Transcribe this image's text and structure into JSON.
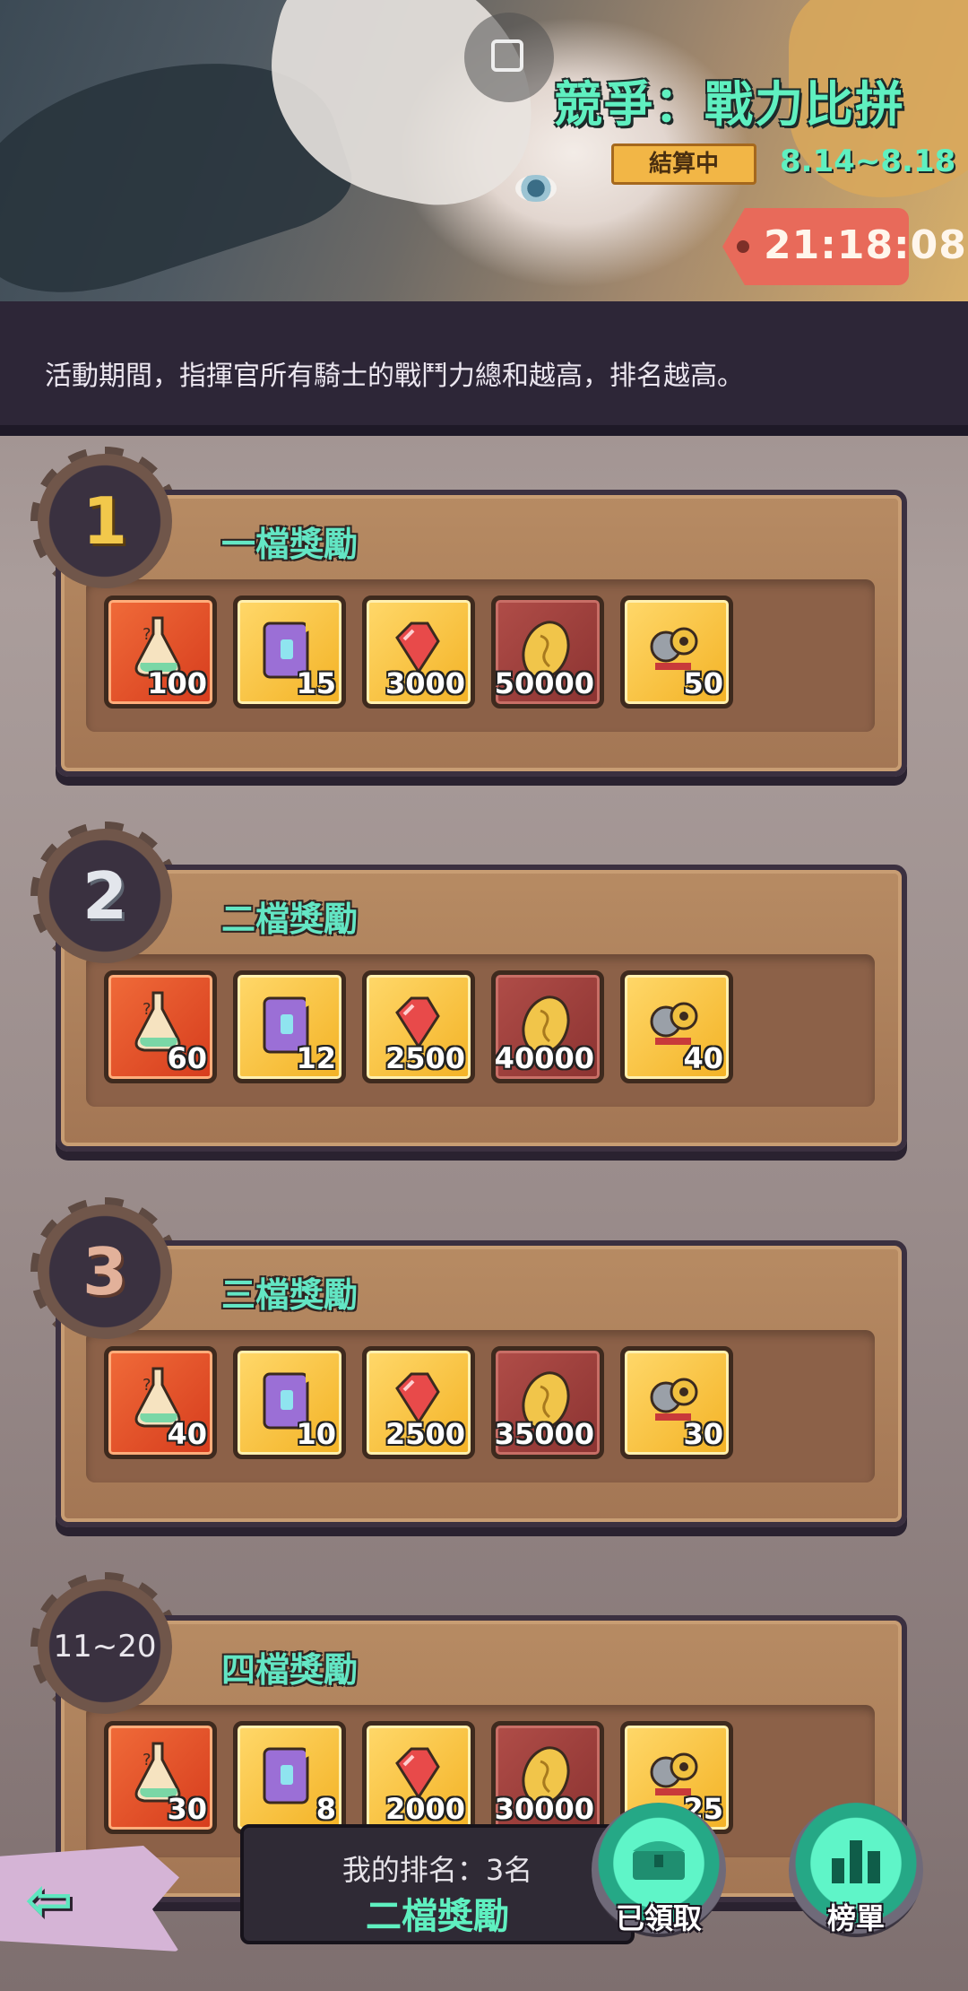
{
  "header": {
    "event_title": "競爭：戰力比拼",
    "status_label": "結算中",
    "date_range": "8.14~8.18",
    "countdown": "21:18:08",
    "description": "活動期間，指揮官所有騎士的戰鬥力總和越高，排名越高。"
  },
  "tiers": [
    {
      "badge": "1",
      "label": "一檔獎勵",
      "items": [
        {
          "icon": "mystery-potion-icon",
          "qty": "100",
          "frame": "red"
        },
        {
          "icon": "spell-book-icon",
          "qty": "15",
          "frame": "gold"
        },
        {
          "icon": "red-gem-icon",
          "qty": "3000",
          "frame": "gold"
        },
        {
          "icon": "gold-coin-icon",
          "qty": "50000",
          "frame": "brown"
        },
        {
          "icon": "gear-parts-icon",
          "qty": "50",
          "frame": "gold"
        }
      ]
    },
    {
      "badge": "2",
      "label": "二檔獎勵",
      "items": [
        {
          "icon": "mystery-potion-icon",
          "qty": "60",
          "frame": "red"
        },
        {
          "icon": "spell-book-icon",
          "qty": "12",
          "frame": "gold"
        },
        {
          "icon": "red-gem-icon",
          "qty": "2500",
          "frame": "gold"
        },
        {
          "icon": "gold-coin-icon",
          "qty": "40000",
          "frame": "brown"
        },
        {
          "icon": "gear-parts-icon",
          "qty": "40",
          "frame": "gold"
        }
      ]
    },
    {
      "badge": "3",
      "label": "三檔獎勵",
      "items": [
        {
          "icon": "mystery-potion-icon",
          "qty": "40",
          "frame": "red"
        },
        {
          "icon": "spell-book-icon",
          "qty": "10",
          "frame": "gold"
        },
        {
          "icon": "red-gem-icon",
          "qty": "2500",
          "frame": "gold"
        },
        {
          "icon": "gold-coin-icon",
          "qty": "35000",
          "frame": "brown"
        },
        {
          "icon": "gear-parts-icon",
          "qty": "30",
          "frame": "gold"
        }
      ]
    },
    {
      "badge": "11~20",
      "label": "四檔獎勵",
      "items": [
        {
          "icon": "mystery-potion-icon",
          "qty": "30",
          "frame": "red"
        },
        {
          "icon": "spell-book-icon",
          "qty": "8",
          "frame": "gold"
        },
        {
          "icon": "red-gem-icon",
          "qty": "2000",
          "frame": "gold"
        },
        {
          "icon": "gold-coin-icon",
          "qty": "30000",
          "frame": "brown"
        },
        {
          "icon": "gear-parts-icon",
          "qty": "25",
          "frame": "gold"
        }
      ]
    }
  ],
  "footer": {
    "my_rank_label": "我的排名：3名",
    "my_reward_tier": "二檔獎勵",
    "claimed_button": "已領取",
    "leaderboard_button": "榜單"
  },
  "colors": {
    "accent_mint": "#5ff0c0",
    "status_gold": "#f2b646",
    "timer_red": "#e86a5a",
    "panel_brown": "#a37654"
  }
}
